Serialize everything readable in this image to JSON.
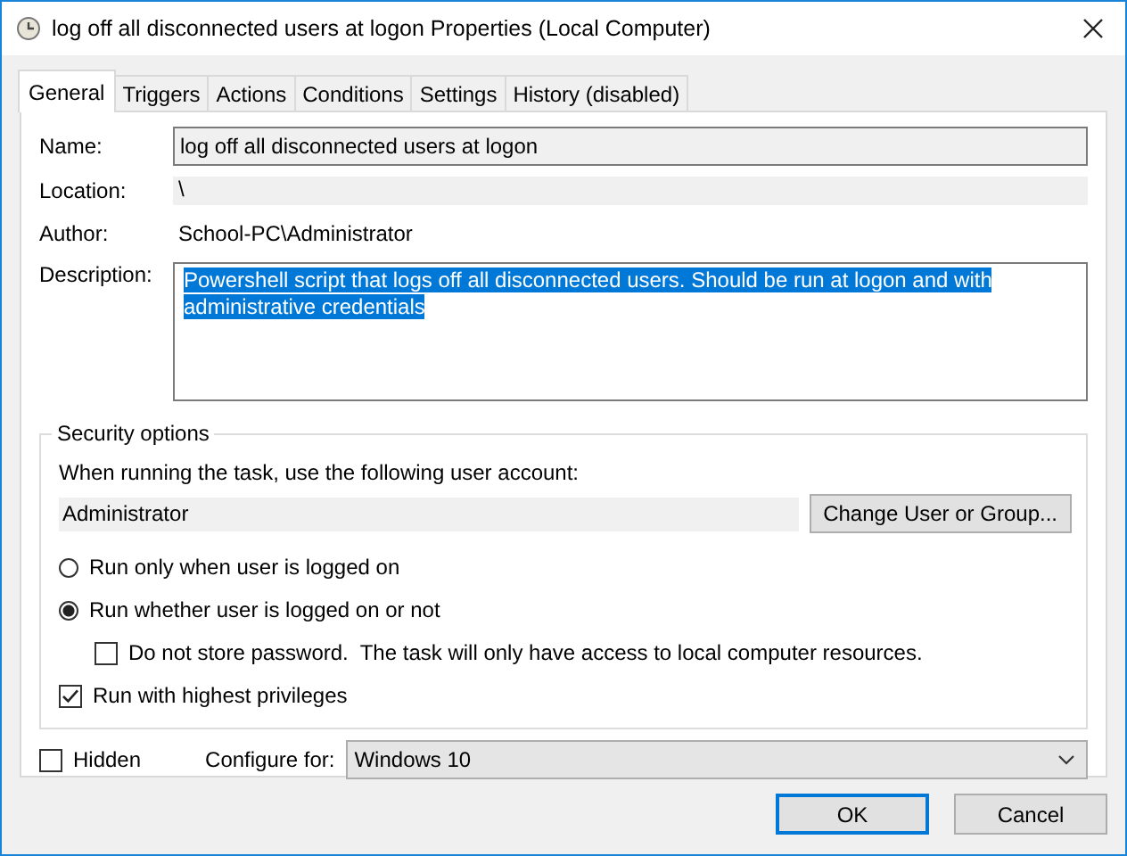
{
  "window": {
    "title": "log off all disconnected users at logon Properties (Local Computer)"
  },
  "tabs": [
    {
      "label": "General",
      "selected": true
    },
    {
      "label": "Triggers",
      "selected": false
    },
    {
      "label": "Actions",
      "selected": false
    },
    {
      "label": "Conditions",
      "selected": false
    },
    {
      "label": "Settings",
      "selected": false
    },
    {
      "label": "History (disabled)",
      "selected": false
    }
  ],
  "general": {
    "name": {
      "label": "Name:",
      "value": "log off all disconnected users at logon"
    },
    "location": {
      "label": "Location:",
      "value": "\\"
    },
    "author": {
      "label": "Author:",
      "value": "School-PC\\Administrator"
    },
    "description": {
      "label": "Description:",
      "value": "Powershell script that logs off all disconnected users. Should be run at logon and with administrative credentials",
      "selected": true
    }
  },
  "security": {
    "title": "Security options",
    "prompt": "When running the task, use the following user account:",
    "account": "Administrator",
    "change_button": "Change User or Group...",
    "run_options": [
      {
        "label": "Run only when user is logged on",
        "selected": false
      },
      {
        "label": "Run whether user is logged on or not",
        "selected": true
      }
    ],
    "do_not_store": {
      "label": "Do not store password.  The task will only have access to local computer resources.",
      "checked": false
    },
    "highest": {
      "label": "Run with highest privileges",
      "checked": true
    }
  },
  "hidden": {
    "label": "Hidden",
    "checked": false
  },
  "configure": {
    "label": "Configure for:",
    "value": "Windows 10"
  },
  "buttons": [
    {
      "label": "OK",
      "default": true
    },
    {
      "label": "Cancel",
      "default": false
    }
  ]
}
